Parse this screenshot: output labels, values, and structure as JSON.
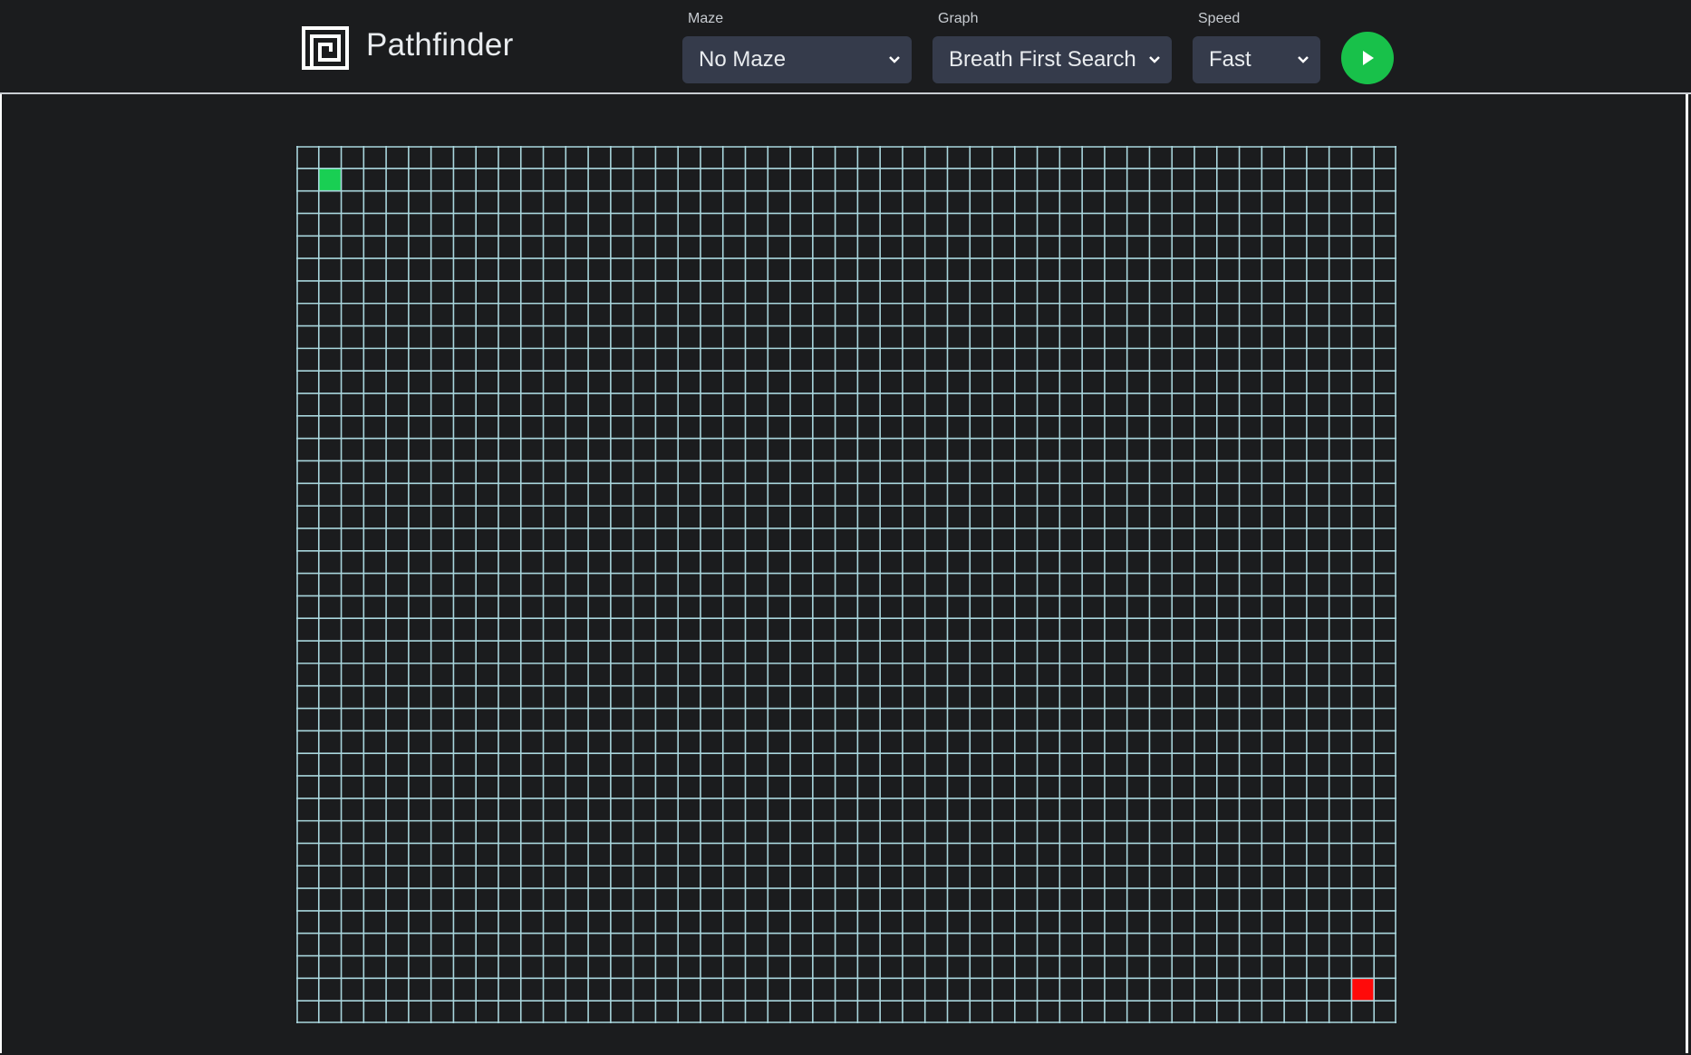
{
  "app": {
    "title": "Pathfinder"
  },
  "controls": {
    "maze": {
      "label": "Maze",
      "value": "No Maze"
    },
    "graph": {
      "label": "Graph",
      "value": "Breath First Search"
    },
    "speed": {
      "label": "Speed",
      "value": "Fast"
    },
    "play_icon": "play-icon"
  },
  "grid": {
    "columns": 49,
    "rows": 39,
    "start_cell": {
      "col": 1,
      "row": 1
    },
    "end_cell": {
      "col": 47,
      "row": 37
    },
    "start_color": "#19cf53",
    "end_color": "#ff0a0a",
    "line_color": "#a9d6dd",
    "background": "#1b1c1e"
  },
  "colors": {
    "accent": "#18c14a",
    "select_bg": "#353b4b",
    "page_bg": "#1b1c1e"
  }
}
